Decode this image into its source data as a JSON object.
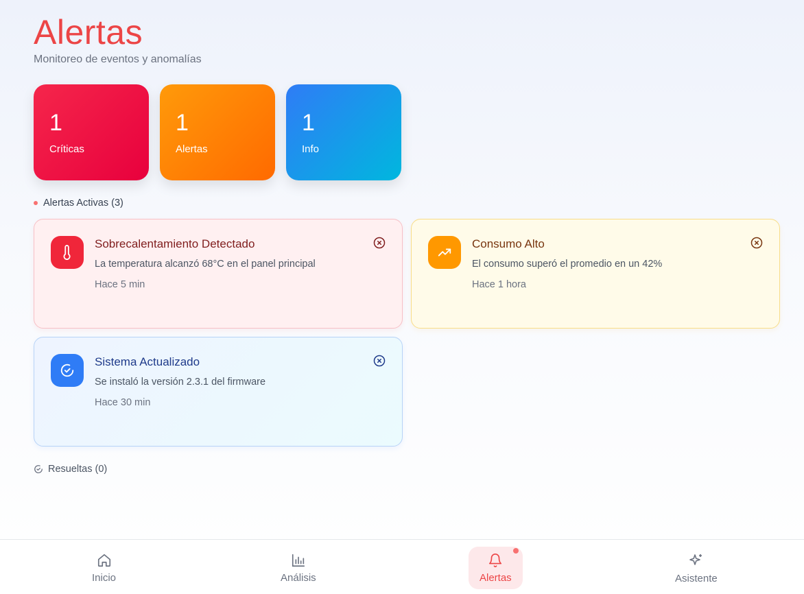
{
  "header": {
    "title": "Alertas",
    "subtitle": "Monitoreo de eventos y anomalías"
  },
  "stats": [
    {
      "value": "1",
      "label": "Críticas",
      "colors": [
        "#f5264b",
        "#e8003d"
      ]
    },
    {
      "value": "1",
      "label": "Alertas",
      "colors": [
        "#ff9a0a",
        "#ff6a00"
      ]
    },
    {
      "value": "1",
      "label": "Info",
      "colors": [
        "#2f7cf6",
        "#00b7de"
      ]
    }
  ],
  "active_section": {
    "label": "Alertas Activas (3)"
  },
  "alerts": [
    {
      "severity": "critical",
      "icon": "thermometer-icon",
      "title": "Sobrecalentamiento Detectado",
      "message": "La temperatura alcanzó 68°C en el panel principal",
      "time": "Hace 5 min"
    },
    {
      "severity": "warning",
      "icon": "trending-up-icon",
      "title": "Consumo Alto",
      "message": "El consumo superó el promedio en un 42%",
      "time": "Hace 1 hora"
    },
    {
      "severity": "info",
      "icon": "check-circle-icon",
      "title": "Sistema Actualizado",
      "message": "Se instaló la versión 2.3.1 del firmware",
      "time": "Hace 30 min"
    }
  ],
  "resolved_section": {
    "label": "Resueltas (0)"
  },
  "nav": {
    "items": [
      {
        "label": "Inicio",
        "icon": "home-icon",
        "active": false
      },
      {
        "label": "Análisis",
        "icon": "bar-chart-icon",
        "active": false
      },
      {
        "label": "Alertas",
        "icon": "bell-icon",
        "active": true
      },
      {
        "label": "Asistente",
        "icon": "sparkles-icon",
        "active": false
      }
    ]
  },
  "colors": {
    "accent": "#ec4546",
    "critical": "#f0263a",
    "warning": "#ff9800",
    "info": "#2f7cf6"
  }
}
